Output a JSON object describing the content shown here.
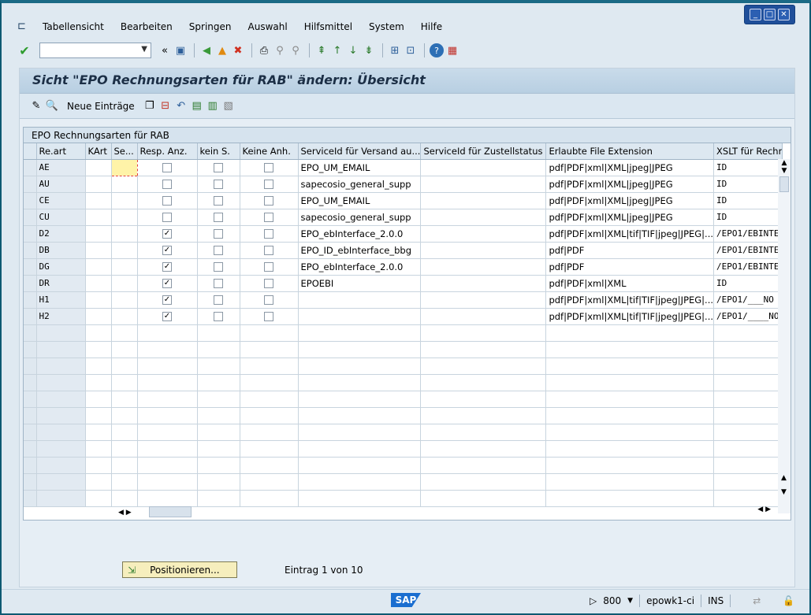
{
  "menu": [
    "Tabellensicht",
    "Bearbeiten",
    "Springen",
    "Auswahl",
    "Hilfsmittel",
    "System",
    "Hilfe"
  ],
  "window_controls": [
    "minimize",
    "maximize",
    "close"
  ],
  "title": "Sicht \"EPO Rechnungsarten für RAB\" ändern: Übersicht",
  "app_toolbar": {
    "new_entries": "Neue Einträge"
  },
  "table": {
    "caption": "EPO Rechnungsarten für RAB",
    "headers": [
      "Re.art",
      "KArt",
      "Se...",
      "Resp. Anz.",
      "kein S.",
      "Keine Anh.",
      "ServiceId für Versand au...",
      "ServiceId für Zustellstatus",
      "Erlaubte File Extension",
      "XSLT für Rechr"
    ],
    "rows": [
      {
        "reart": "AE",
        "kart": "",
        "se": "",
        "resp": false,
        "kein": false,
        "keine": false,
        "svc": "EPO_UM_EMAIL",
        "zust": "",
        "ext": "pdf|PDF|xml|XML|jpeg|JPEG",
        "xslt": "ID"
      },
      {
        "reart": "AU",
        "kart": "",
        "se": "",
        "resp": false,
        "kein": false,
        "keine": false,
        "svc": "sapecosio_general_supp",
        "zust": "",
        "ext": "pdf|PDF|xml|XML|jpeg|JPEG",
        "xslt": "ID"
      },
      {
        "reart": "CE",
        "kart": "",
        "se": "",
        "resp": false,
        "kein": false,
        "keine": false,
        "svc": "EPO_UM_EMAIL",
        "zust": "",
        "ext": "pdf|PDF|xml|XML|jpeg|JPEG",
        "xslt": "ID"
      },
      {
        "reart": "CU",
        "kart": "",
        "se": "",
        "resp": false,
        "kein": false,
        "keine": false,
        "svc": "sapecosio_general_supp",
        "zust": "",
        "ext": "pdf|PDF|xml|XML|jpeg|JPEG",
        "xslt": "ID"
      },
      {
        "reart": "D2",
        "kart": "",
        "se": "",
        "resp": true,
        "kein": false,
        "keine": false,
        "svc": "EPO_ebInterface_2.0.0",
        "zust": "",
        "ext": "pdf|PDF|xml|XML|tif|TIF|jpeg|JPEG|...",
        "xslt": "/EPO1/EBINTE"
      },
      {
        "reart": "DB",
        "kart": "",
        "se": "",
        "resp": true,
        "kein": false,
        "keine": false,
        "svc": "EPO_ID_ebInterface_bbg",
        "zust": "",
        "ext": "pdf|PDF",
        "xslt": "/EPO1/EBINTE"
      },
      {
        "reart": "DG",
        "kart": "",
        "se": "",
        "resp": true,
        "kein": false,
        "keine": false,
        "svc": "EPO_ebInterface_2.0.0",
        "zust": "",
        "ext": "pdf|PDF",
        "xslt": "/EPO1/EBINTE"
      },
      {
        "reart": "DR",
        "kart": "",
        "se": "",
        "resp": true,
        "kein": false,
        "keine": false,
        "svc": "EPOEBI",
        "zust": "",
        "ext": "pdf|PDF|xml|XML",
        "xslt": "ID"
      },
      {
        "reart": "H1",
        "kart": "",
        "se": "",
        "resp": true,
        "kein": false,
        "keine": false,
        "svc": "",
        "zust": "",
        "ext": "pdf|PDF|xml|XML|tif|TIF|jpeg|JPEG|...",
        "xslt": "/EPO1/___NO"
      },
      {
        "reart": "H2",
        "kart": "",
        "se": "",
        "resp": true,
        "kein": false,
        "keine": false,
        "svc": "",
        "zust": "",
        "ext": "pdf|PDF|xml|XML|tif|TIF|jpeg|JPEG|...",
        "xslt": "/EPO1/____NO"
      }
    ],
    "empty_rows": 11
  },
  "bottom": {
    "position_button": "Positionieren...",
    "entry_info": "Eintrag 1 von 10"
  },
  "status": {
    "logo": "SAP",
    "client": "800",
    "server": "epowk1-ci",
    "mode": "INS"
  }
}
